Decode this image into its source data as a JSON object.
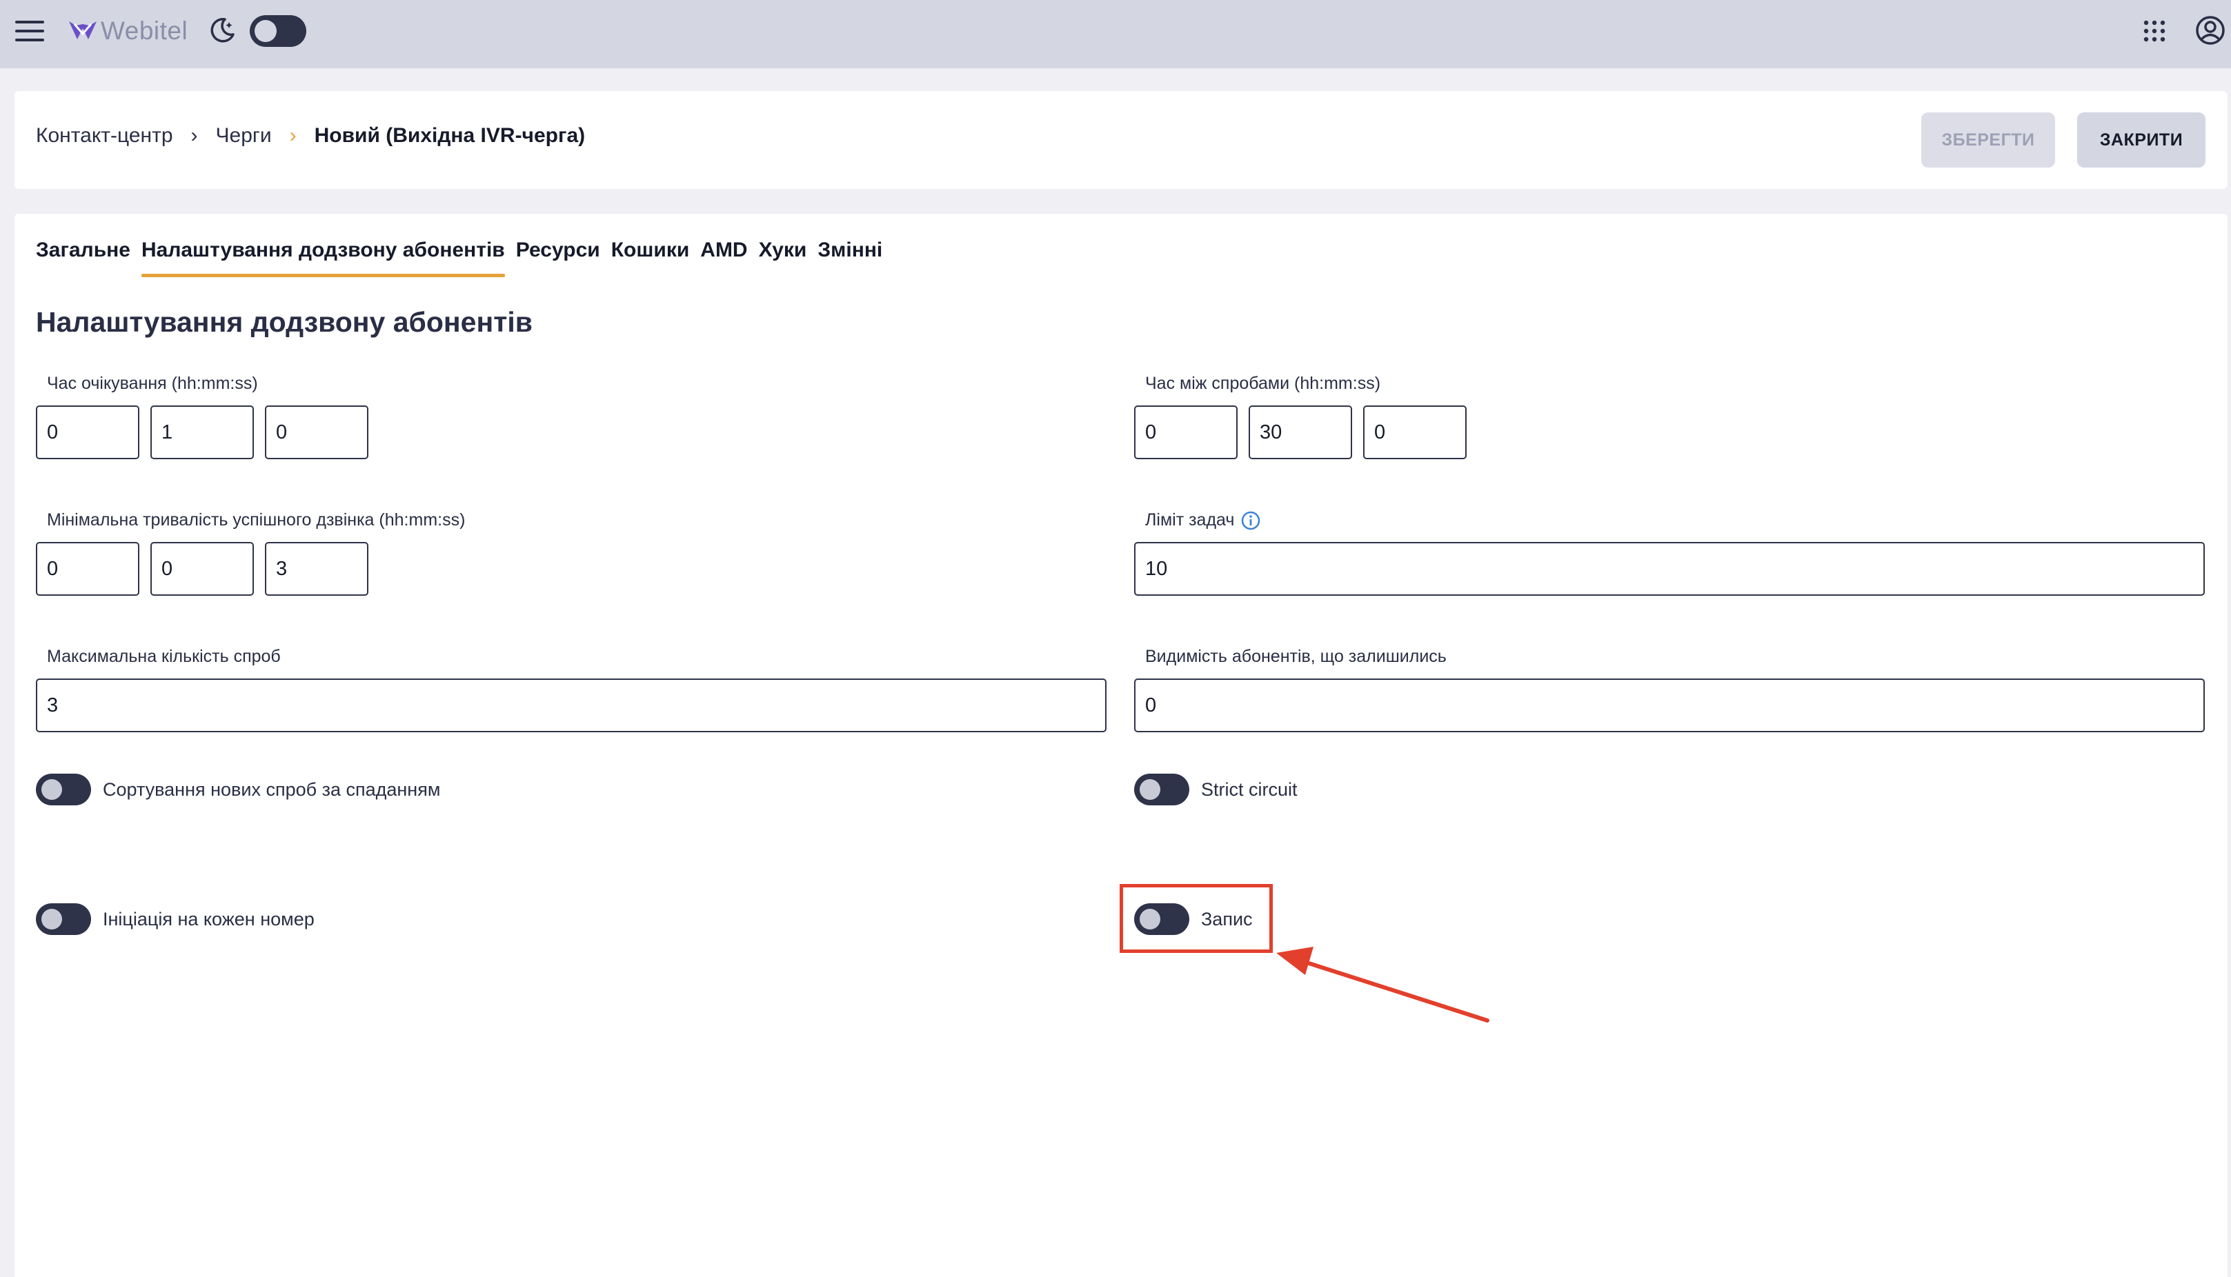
{
  "app": {
    "logo_text": "Webitel",
    "theme_toggle_on": true,
    "colors": {
      "accent": "#e6a33a",
      "dark": "#2f3349",
      "appbar": "#d4d6e2",
      "annotation": "#e2402c"
    }
  },
  "breadcrumb": {
    "items": [
      "Контакт-центр",
      "Черги",
      "Новий (Вихідна IVR-черга)"
    ],
    "separator": "›"
  },
  "buttons": {
    "save": "ЗБЕРЕГТИ",
    "close": "ЗАКРИТИ"
  },
  "tabs": [
    {
      "label": "Загальне",
      "active": false
    },
    {
      "label": "Налаштування додзвону абонентів",
      "active": true
    },
    {
      "label": "Ресурси",
      "active": false
    },
    {
      "label": "Кошики",
      "active": false
    },
    {
      "label": "AMD",
      "active": false
    },
    {
      "label": "Хуки",
      "active": false
    },
    {
      "label": "Змінні",
      "active": false
    }
  ],
  "section": {
    "title": "Налаштування додзвону абонентів"
  },
  "fields": {
    "wait_time": {
      "label": "Час очікування (hh:mm:ss)",
      "hh": "0",
      "mm": "1",
      "ss": "0"
    },
    "retry_interval": {
      "label": "Час між спробами (hh:mm:ss)",
      "hh": "0",
      "mm": "30",
      "ss": "0"
    },
    "min_call_duration": {
      "label": "Мінімальна тривалість успішного дзвінка (hh:mm:ss)",
      "hh": "0",
      "mm": "0",
      "ss": "3"
    },
    "task_limit": {
      "label": "Ліміт задач",
      "value": "10"
    },
    "max_attempts": {
      "label": "Максимальна кількість спроб",
      "value": "3"
    },
    "remaining_visibility": {
      "label": "Видимість абонентів, що залишились",
      "value": "0"
    }
  },
  "toggles": {
    "sort_desc": {
      "label": "Сортування нових спроб за спаданням",
      "on": false
    },
    "strict_circuit": {
      "label": "Strict circuit",
      "on": false
    },
    "per_number": {
      "label": "Ініціація на кожен номер",
      "on": false
    },
    "recording": {
      "label": "Запис",
      "on": false
    }
  }
}
